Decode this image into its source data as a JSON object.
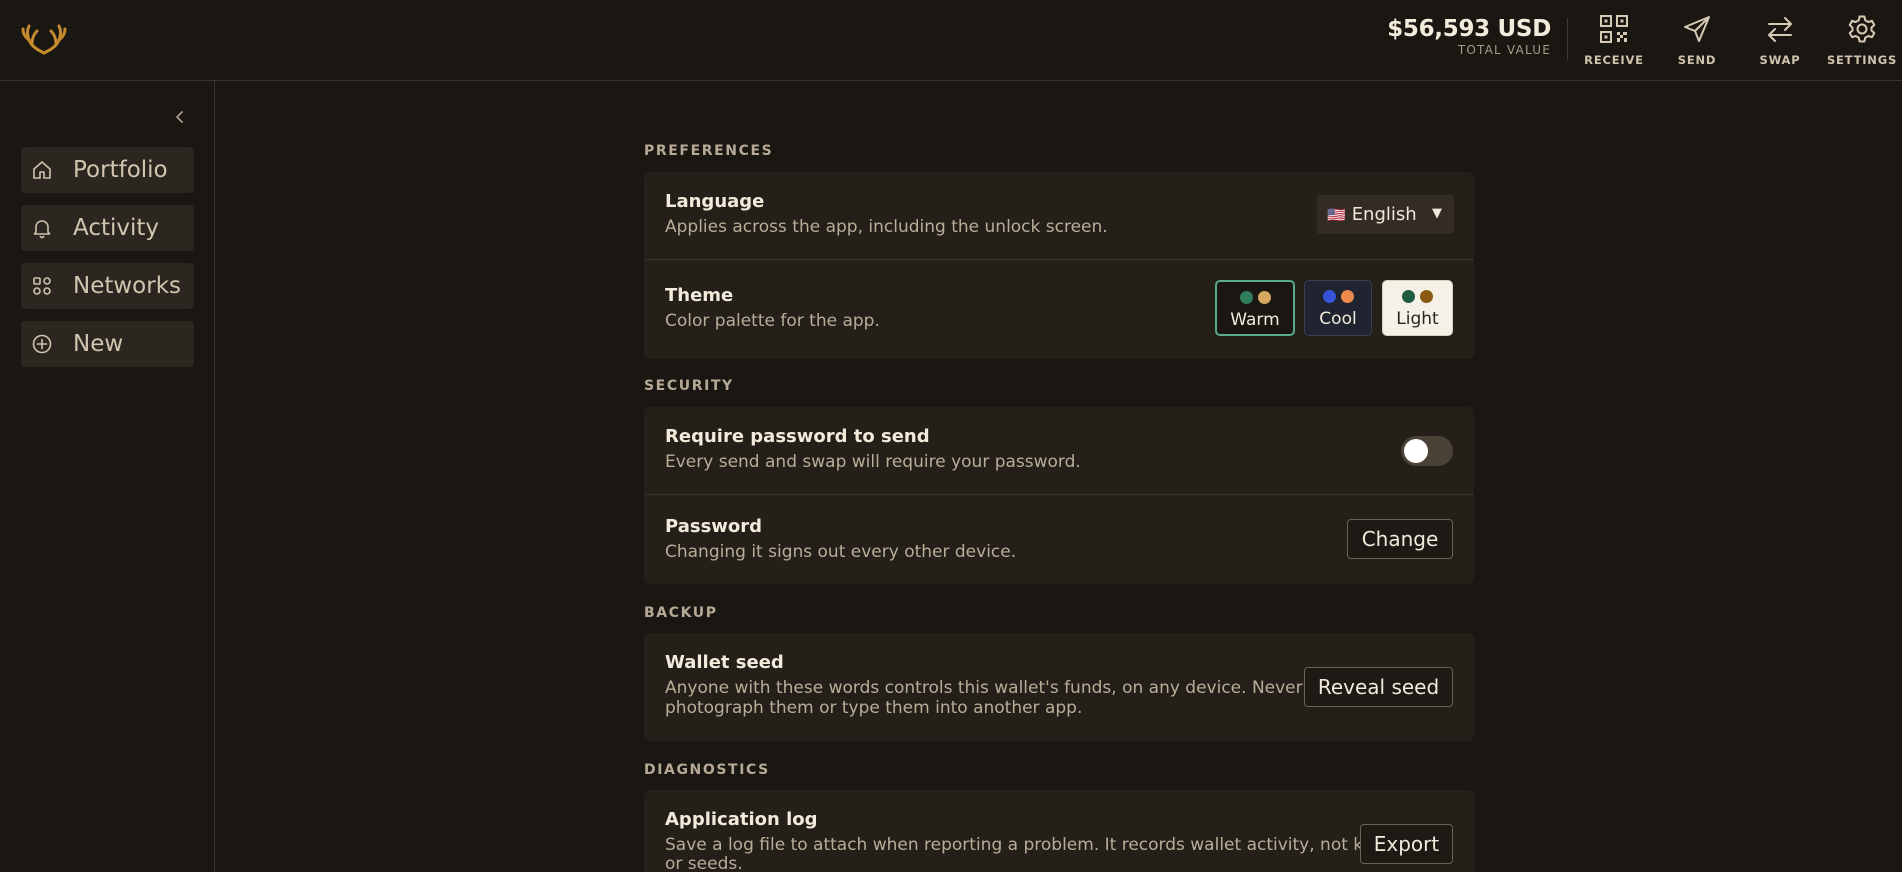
{
  "header": {
    "total_value": "$56,593 USD",
    "total_label": "TOTAL VALUE",
    "actions": [
      {
        "label": "RECEIVE",
        "icon": "qr-code-icon"
      },
      {
        "label": "SEND",
        "icon": "send-icon"
      },
      {
        "label": "SWAP",
        "icon": "swap-icon"
      },
      {
        "label": "SETTINGS",
        "icon": "gear-icon"
      }
    ]
  },
  "sidebar": {
    "items": [
      {
        "label": "Portfolio",
        "icon": "home-icon"
      },
      {
        "label": "Activity",
        "icon": "bell-icon"
      },
      {
        "label": "Networks",
        "icon": "networks-icon"
      },
      {
        "label": "New",
        "icon": "plus-circle-icon"
      }
    ]
  },
  "sections": {
    "preferences": "PREFERENCES",
    "security": "SECURITY",
    "backup": "BACKUP",
    "diagnostics": "DIAGNOSTICS"
  },
  "language": {
    "title": "Language",
    "desc": "Applies across the app, including the unlock screen.",
    "flag": "🇺🇸",
    "selected": "English"
  },
  "theme": {
    "title": "Theme",
    "desc": "Color palette for the app.",
    "options": [
      {
        "name": "Warm",
        "selected": true,
        "colors": [
          "#2f7d5a",
          "#d7a95e"
        ]
      },
      {
        "name": "Cool",
        "selected": false,
        "colors": [
          "#3553d6",
          "#ee8a4c"
        ]
      },
      {
        "name": "Light",
        "selected": false,
        "colors": [
          "#1f5b43",
          "#8a5a12"
        ]
      }
    ]
  },
  "require_password": {
    "title": "Require password to send",
    "desc": "Every send and swap will require your password.",
    "enabled": false
  },
  "password": {
    "title": "Password",
    "desc": "Changing it signs out every other device.",
    "button": "Change"
  },
  "wallet_seed": {
    "title": "Wallet seed",
    "desc_line1": "Anyone with these words controls this wallet's funds, on any device. Never",
    "desc_line2": "photograph them or type them into another app.",
    "button": "Reveal seed"
  },
  "app_log": {
    "title": "Application log",
    "desc_line1": "Save a log file to attach when reporting a problem. It records wallet activity, not keys",
    "desc_line2": "or seeds.",
    "button": "Export"
  },
  "colors": {
    "accent": "#5aa98a",
    "background": "#1a1611",
    "card": "#241f19"
  }
}
